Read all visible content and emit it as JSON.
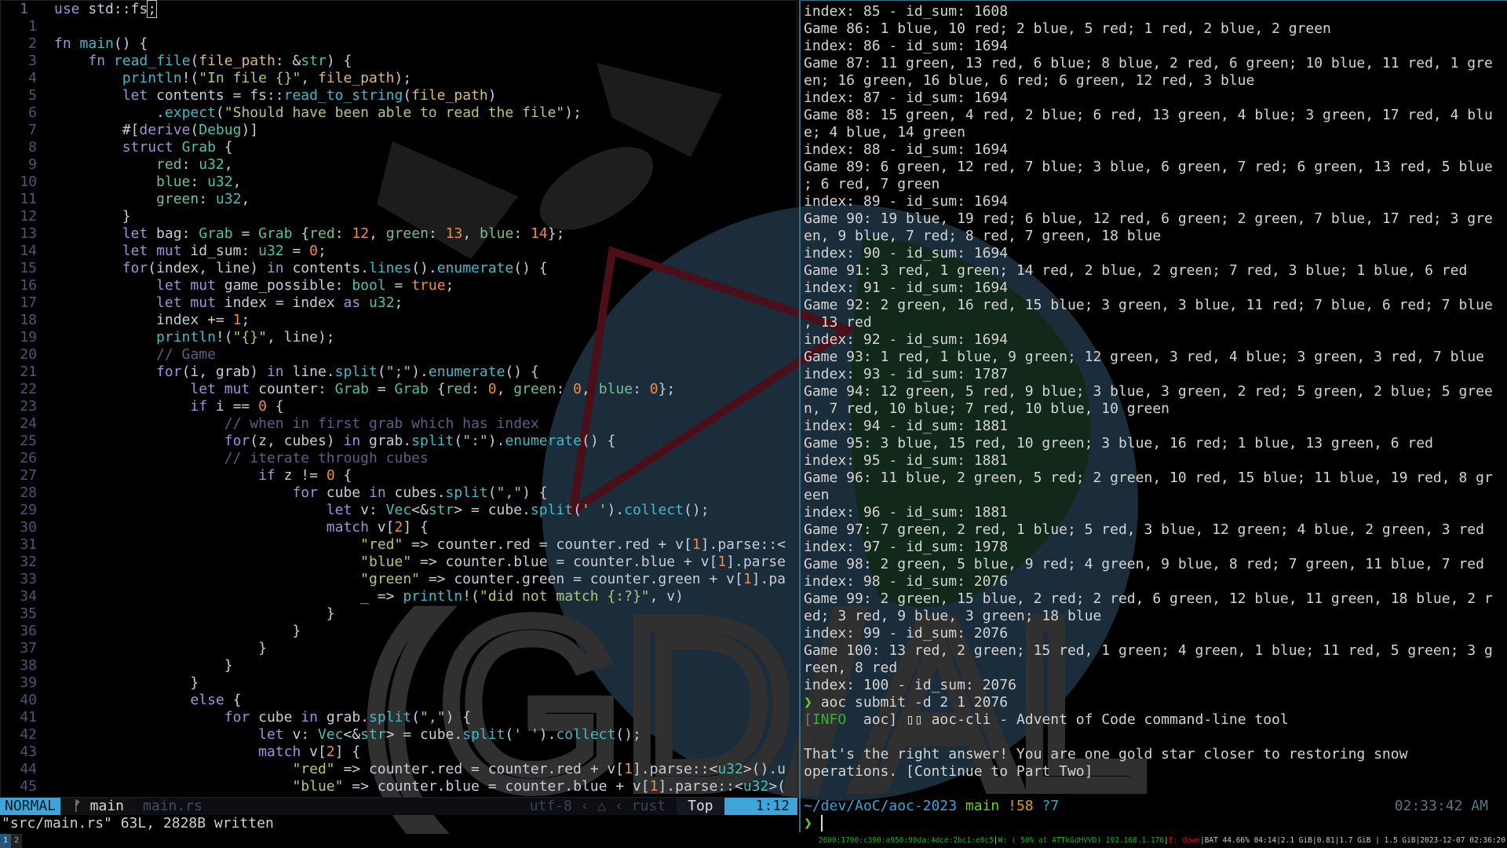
{
  "editor": {
    "current_line_number": "1",
    "code": [
      "use std::fs;",
      "",
      "fn main() {",
      "    fn read_file(file_path: &str) {",
      "        println!(\"In file {}\", file_path);",
      "        let contents = fs::read_to_string(file_path)",
      "            .expect(\"Should have been able to read the file\");",
      "        #[derive(Debug)]",
      "        struct Grab {",
      "            red: u32,",
      "            blue: u32,",
      "            green: u32,",
      "        }",
      "        let bag: Grab = Grab {red: 12, green: 13, blue: 14};",
      "        let mut id_sum: u32 = 0;",
      "        for(index, line) in contents.lines().enumerate() {",
      "            let mut game_possible: bool = true;",
      "            let mut index = index as u32;",
      "            index += 1;",
      "            println!(\"{}\", line);",
      "            // Game",
      "            for(i, grab) in line.split(\";\").enumerate() {",
      "                let mut counter: Grab = Grab {red: 0, green: 0, blue: 0};",
      "                if i == 0 {",
      "                    // when in first grab which has index",
      "                    for(z, cubes) in grab.split(\":\").enumerate() {",
      "                    // iterate through cubes",
      "                        if z != 0 {",
      "                            for cube in cubes.split(\",\") {",
      "                                let v: Vec<&str> = cube.split(' ').collect();",
      "                                match v[2] {",
      "                                    \"red\" => counter.red = counter.red + v[1].parse::<",
      "                                    \"blue\" => counter.blue = counter.blue + v[1].parse",
      "                                    \"green\" => counter.green = counter.green + v[1].pa",
      "                                    _ => println!(\"did not match {:?}\", v)",
      "                                }",
      "                            }",
      "                        }",
      "                    }",
      "                }",
      "                else {",
      "                    for cube in grab.split(\",\") {",
      "                        let v: Vec<&str> = cube.split(' ').collect();",
      "                        match v[2] {",
      "                            \"red\" => counter.red = counter.red + v[1].parse::<u32>().u",
      "                            \"blue\" => counter.blue = counter.blue + v[1].parse::<u32>("
    ],
    "statusline": {
      "mode": "NORMAL",
      "branch_icon": "git-branch-icon",
      "branch": "main",
      "filename": "main.rs",
      "encoding": "utf-8",
      "os_icon": "linux-tux-icon",
      "filetype": "rust",
      "scroll": "Top",
      "position": "1:12"
    },
    "cmdline": "\"src/main.rs\" 63L, 2828B written"
  },
  "terminal": {
    "output": [
      "index: 85 - id_sum: 1608",
      "Game 86: 1 blue, 10 red; 2 blue, 5 red; 1 red, 2 blue, 2 green",
      "index: 86 - id_sum: 1694",
      "Game 87: 11 green, 13 red, 6 blue; 8 blue, 2 red, 6 green; 10 blue, 11 red, 1 gre",
      "en; 16 green, 16 blue, 6 red; 6 green, 12 red, 3 blue",
      "index: 87 - id_sum: 1694",
      "Game 88: 15 green, 4 red, 2 blue; 6 red, 13 green, 4 blue; 3 green, 17 red, 4 blu",
      "e; 4 blue, 14 green",
      "index: 88 - id_sum: 1694",
      "Game 89: 6 green, 12 red, 7 blue; 3 blue, 6 green, 7 red; 6 green, 13 red, 5 blue",
      "; 6 red, 7 green",
      "index: 89 - id_sum: 1694",
      "Game 90: 19 blue, 19 red; 6 blue, 12 red, 6 green; 2 green, 7 blue, 17 red; 3 gre",
      "en, 9 blue, 7 red; 8 red, 7 green, 18 blue",
      "index: 90 - id_sum: 1694",
      "Game 91: 3 red, 1 green; 14 red, 2 blue, 2 green; 7 red, 3 blue; 1 blue, 6 red",
      "index: 91 - id_sum: 1694",
      "Game 92: 2 green, 16 red, 15 blue; 3 green, 3 blue, 11 red; 7 blue, 6 red; 7 blue",
      ", 13 red",
      "index: 92 - id_sum: 1694",
      "Game 93: 1 red, 1 blue, 9 green; 12 green, 3 red, 4 blue; 3 green, 3 red, 7 blue",
      "index: 93 - id_sum: 1787",
      "Game 94: 12 green, 5 red, 9 blue; 3 blue, 3 green, 2 red; 5 green, 2 blue; 5 gree",
      "n, 7 red, 10 blue; 7 red, 10 blue, 10 green",
      "index: 94 - id_sum: 1881",
      "Game 95: 3 blue, 15 red, 10 green; 3 blue, 16 red; 1 blue, 13 green, 6 red",
      "index: 95 - id_sum: 1881",
      "Game 96: 11 blue, 2 green, 5 red; 2 green, 10 red, 15 blue; 11 blue, 19 red, 8 gr",
      "een",
      "index: 96 - id_sum: 1881",
      "Game 97: 7 green, 2 red, 1 blue; 5 red, 3 blue, 12 green; 4 blue, 2 green, 3 red",
      "index: 97 - id_sum: 1978",
      "Game 98: 2 green, 5 blue, 9 red; 4 green, 9 blue, 8 red; 7 green, 11 blue, 7 red",
      "index: 98 - id_sum: 2076",
      "Game 99: 2 green, 15 blue, 2 red; 2 red, 6 green, 12 blue, 11 green, 18 blue, 2 r",
      "ed; 3 red, 9 blue, 3 green; 18 blue",
      "index: 99 - id_sum: 2076",
      "Game 100: 13 red, 2 green; 15 red, 1 green; 4 green, 1 blue; 11 red, 5 green; 3 g",
      "reen, 8 red",
      "index: 100 - id_sum: 2076"
    ],
    "prompt_symbol": "❯",
    "command": "aoc submit -d 2 1 2076",
    "info_open": "[",
    "info_level": "INFO",
    "info_rest": "  aoc] ▯▯ aoc-cli - Advent of Code command-line tool",
    "answer_line1": "That's the right answer! You are one gold star closer to restoring snow",
    "answer_line2": "operations. [Continue to Part Two]",
    "prompt_path": "~/dev/AoC/aoc-2023",
    "prompt_branch": "main",
    "prompt_modified": "!58",
    "prompt_untracked": "?7",
    "clock": "02:33:42 AM"
  },
  "bar": {
    "workspaces": [
      "1",
      "2"
    ],
    "ipv6": "2600:1700:c390:a950:90da:4dce:2bc1:e0c5",
    "wifi": "W: ( 50% at ATTkGdHVVD) 192.168.1.176",
    "ethernet": "E: down",
    "battery": "BAT 44.66% 04:14",
    "mem1": "2.1 GiB",
    "load": "0.81",
    "mem2": "1.7 GiB",
    "disk": "1.5 GiB",
    "datetime": "2023-12-07 02:36:20"
  },
  "wallpaper": {
    "logo_text": "GDAL"
  }
}
